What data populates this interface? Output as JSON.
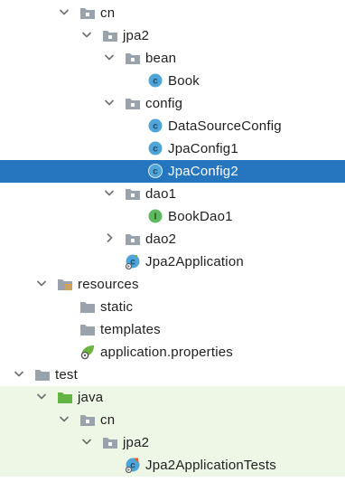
{
  "project_tree": {
    "rows": [
      {
        "label": "cn",
        "icon": "package-folder-icon",
        "expanded": true,
        "depth": 2
      },
      {
        "label": "jpa2",
        "icon": "package-folder-icon",
        "expanded": true,
        "depth": 3
      },
      {
        "label": "bean",
        "icon": "package-folder-icon",
        "expanded": true,
        "depth": 4
      },
      {
        "label": "Book",
        "icon": "class-icon",
        "depth": 5
      },
      {
        "label": "config",
        "icon": "package-folder-icon",
        "expanded": true,
        "depth": 4
      },
      {
        "label": "DataSourceConfig",
        "icon": "class-icon",
        "depth": 5
      },
      {
        "label": "JpaConfig1",
        "icon": "class-icon",
        "depth": 5
      },
      {
        "label": "JpaConfig2",
        "icon": "class-icon",
        "depth": 5,
        "selected": true
      },
      {
        "label": "dao1",
        "icon": "package-folder-icon",
        "expanded": true,
        "depth": 4
      },
      {
        "label": "BookDao1",
        "icon": "interface-icon",
        "depth": 5
      },
      {
        "label": "dao2",
        "icon": "package-folder-icon",
        "expanded": false,
        "depth": 4
      },
      {
        "label": "Jpa2Application",
        "icon": "spring-boot-class-icon",
        "depth": 4
      },
      {
        "label": "resources",
        "icon": "resources-folder-icon",
        "expanded": true,
        "depth": 1
      },
      {
        "label": "static",
        "icon": "folder-icon",
        "depth": 2
      },
      {
        "label": "templates",
        "icon": "folder-icon",
        "depth": 2
      },
      {
        "label": "application.properties",
        "icon": "spring-properties-icon",
        "depth": 2
      },
      {
        "label": "test",
        "icon": "folder-icon",
        "expanded": true,
        "depth": 0
      },
      {
        "label": "java",
        "icon": "test-sources-folder-icon",
        "expanded": true,
        "depth": 1,
        "test": true
      },
      {
        "label": "cn",
        "icon": "package-folder-icon",
        "expanded": true,
        "depth": 2,
        "test": true
      },
      {
        "label": "jpa2",
        "icon": "package-folder-icon",
        "expanded": true,
        "depth": 3,
        "test": true
      },
      {
        "label": "Jpa2ApplicationTests",
        "icon": "spring-boot-test-class-icon",
        "depth": 4,
        "test": true
      }
    ]
  },
  "colors": {
    "selection_bg": "#2675bf",
    "test_area_bg": "#eef6e6",
    "folder_gray": "#9aa3ac",
    "class_blue": "#4fa5d8",
    "interface_green": "#5fb95f",
    "test_folder_green": "#62b543",
    "spring_green": "#6db33f"
  }
}
